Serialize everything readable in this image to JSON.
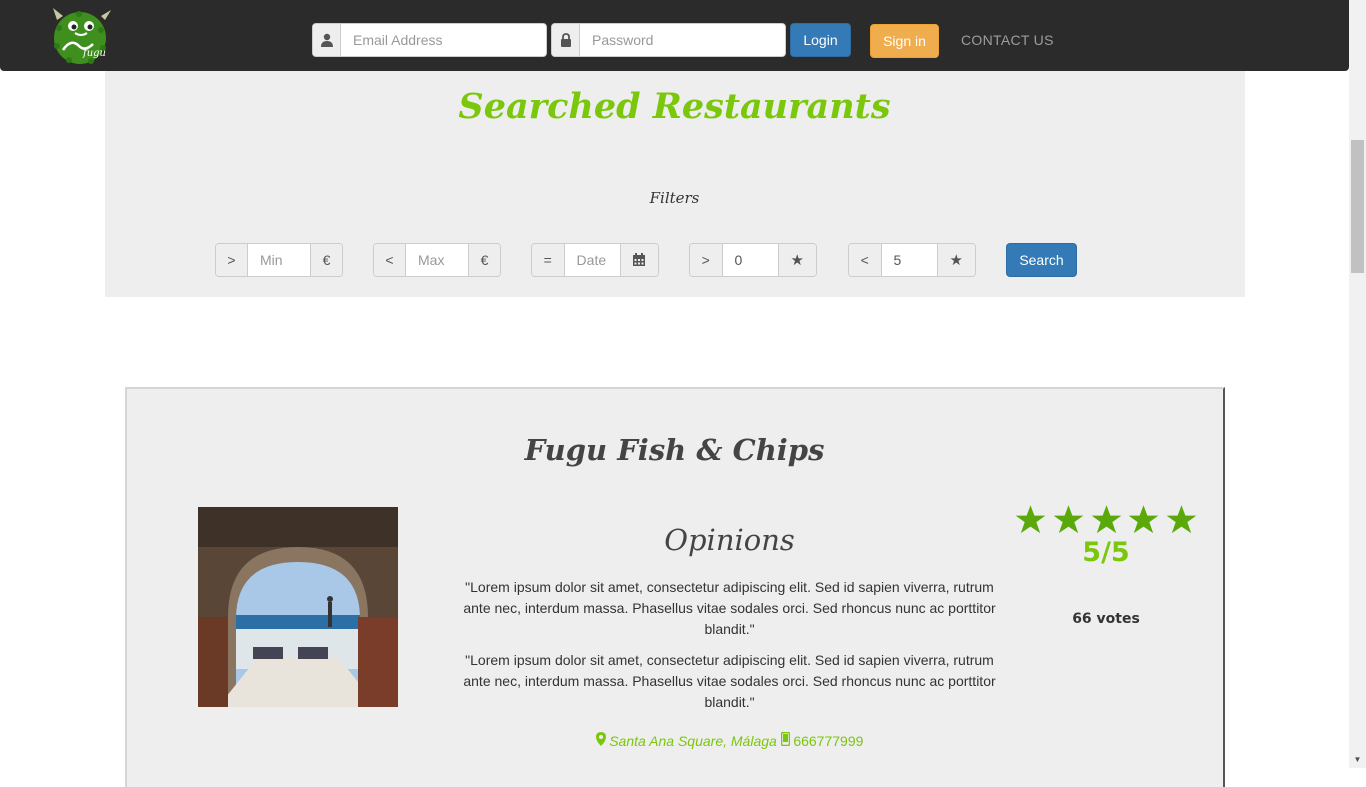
{
  "navbar": {
    "logo_icon": "fugu-logo-icon",
    "email_placeholder": "Email Address",
    "password_placeholder": "Password",
    "login_label": "Login",
    "signin_label": "Sign in",
    "contact_label": "CONTACT US"
  },
  "page": {
    "title": "Searched Restaurants",
    "filters_label": "Filters"
  },
  "filters": [
    {
      "prefix": ">",
      "placeholder": "Min",
      "value": "",
      "suffix": "€",
      "suffix_icon": "euro-icon"
    },
    {
      "prefix": "<",
      "placeholder": "Max",
      "value": "",
      "suffix": "€",
      "suffix_icon": "euro-icon"
    },
    {
      "prefix": "=",
      "placeholder": "Date",
      "value": "",
      "suffix": "",
      "suffix_icon": "calendar-icon"
    },
    {
      "prefix": ">",
      "placeholder": "",
      "value": "0",
      "suffix": "★",
      "suffix_icon": "star-icon"
    },
    {
      "prefix": "<",
      "placeholder": "",
      "value": "5",
      "suffix": "★",
      "suffix_icon": "star-icon"
    }
  ],
  "search_label": "Search",
  "restaurant": {
    "name": "Fugu Fish & Chips",
    "opinions_title": "Opinions",
    "opinions": [
      "\"Lorem ipsum dolor sit amet, consectetur adipiscing elit. Sed id sapien viverra, rutrum ante nec, interdum massa. Phasellus vitae sodales orci. Sed rhoncus nunc ac porttitor blandit.\"",
      "\"Lorem ipsum dolor sit amet, consectetur adipiscing elit. Sed id sapien viverra, rutrum ante nec, interdum massa. Phasellus vitae sodales orci. Sed rhoncus nunc ac porttitor blandit.\""
    ],
    "address": "Santa Ana Square, Málaga",
    "phone": "666777999",
    "stars_filled": 5,
    "stars_total": 5,
    "rating": "5/5",
    "votes": "66 votes"
  },
  "colors": {
    "accent_green": "#7ac70c",
    "primary_blue": "#337ab7",
    "warning_orange": "#f0ad4e",
    "navbar_dark": "#2b2b2b",
    "panel_gray": "#eeeeee"
  }
}
